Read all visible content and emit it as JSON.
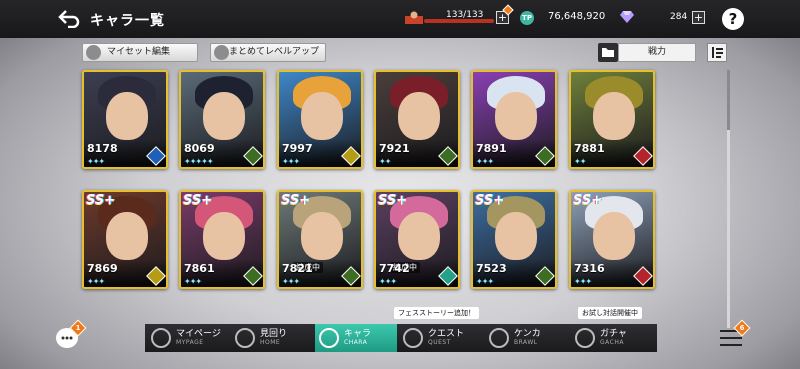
{
  "header": {
    "title": "キャラ一覧",
    "stamina": "133/133",
    "coins_icon": "TP",
    "coins": "76,648,920",
    "gems": "284",
    "plus": "+",
    "help": "?"
  },
  "toolbar": {
    "myset_label": "マイセット編集",
    "levelup_label": "まとめてレベルアップ",
    "sort_label": "戦力"
  },
  "cards": [
    {
      "power": "8178",
      "stars": "✦✦✦",
      "attr_color": "#1f5fb8",
      "hair": "#2b2b3c",
      "bg": "#3c3f52",
      "rank": "",
      "status": ""
    },
    {
      "power": "8069",
      "stars": "✦✦✦✦✦",
      "attr_color": "#3d6d22",
      "hair": "#1e2230",
      "bg": "#5a6b78",
      "rank": "",
      "status": ""
    },
    {
      "power": "7997",
      "stars": "✦✦✦",
      "attr_color": "#b69b15",
      "hair": "#e8a23a",
      "bg": "#3f87c9",
      "rank": "",
      "status": ""
    },
    {
      "power": "7921",
      "stars": "✦✦",
      "attr_color": "#3d6d22",
      "hair": "#7a1f2a",
      "bg": "#4b3e3a",
      "rank": "",
      "status": ""
    },
    {
      "power": "7891",
      "stars": "✦✦✦",
      "attr_color": "#3d6d22",
      "hair": "#d9e4f0",
      "bg": "#8a3fb3",
      "rank": "",
      "status": ""
    },
    {
      "power": "7881",
      "stars": "✦✦",
      "attr_color": "#b3252b",
      "hair": "#9a8c2a",
      "bg": "#6f7f3a",
      "rank": "",
      "status": ""
    },
    {
      "power": "7869",
      "stars": "✦✦✦",
      "attr_color": "#b69b15",
      "hair": "#5a2a1c",
      "bg": "#6e3a2a",
      "rank": "SS+",
      "status": ""
    },
    {
      "power": "7861",
      "stars": "✦✦✦",
      "attr_color": "#3d6d22",
      "hair": "#d4577a",
      "bg": "#7a3b6a",
      "rank": "SS+",
      "status": ""
    },
    {
      "power": "7821",
      "stars": "✦✦✦",
      "attr_color": "#3d6d22",
      "hair": "#b8a37a",
      "bg": "#6e7a78",
      "rank": "SS+",
      "status": "編成中"
    },
    {
      "power": "7742",
      "stars": "✦✦✦",
      "attr_color": "#27a08a",
      "hair": "#d46a9b",
      "bg": "#5c4060",
      "rank": "SS+",
      "status": "編成中"
    },
    {
      "power": "7523",
      "stars": "✦✦✦",
      "attr_color": "#3d6d22",
      "hair": "#a39660",
      "bg": "#3d6fa3",
      "rank": "SS+",
      "status": ""
    },
    {
      "power": "7316",
      "stars": "✦✦✦",
      "attr_color": "#b3252b",
      "hair": "#e4e6ee",
      "bg": "#8ea1b8",
      "rank": "SS+",
      "status": ""
    }
  ],
  "tooltips": {
    "festival": "フェスストーリー追加！",
    "trial": "お試し対話開催中"
  },
  "nav": [
    {
      "jp": "マイページ",
      "en": "MYPAGE"
    },
    {
      "jp": "見回り",
      "en": "HOME"
    },
    {
      "jp": "キャラ",
      "en": "CHARA"
    },
    {
      "jp": "クエスト",
      "en": "QUEST"
    },
    {
      "jp": "ケンカ",
      "en": "BRAWL"
    },
    {
      "jp": "ガチャ",
      "en": "GACHA"
    }
  ],
  "badges": {
    "chat": "1",
    "menu": "6"
  },
  "colors": {
    "accent": "#2bb59b",
    "notify": "#f07a1a",
    "card_border": "#e5c02a"
  }
}
